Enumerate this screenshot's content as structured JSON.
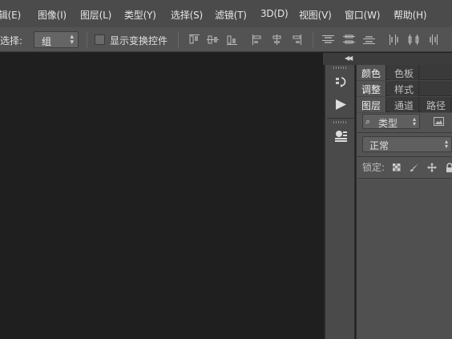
{
  "menubar": {
    "items": [
      {
        "label": "编辑(E)"
      },
      {
        "label": "图像(I)"
      },
      {
        "label": "图层(L)"
      },
      {
        "label": "类型(Y)"
      },
      {
        "label": "选择(S)"
      },
      {
        "label": "滤镜(T)"
      },
      {
        "label": "3D(D)"
      },
      {
        "label": "视图(V)"
      },
      {
        "label": "窗口(W)"
      },
      {
        "label": "帮助(H)"
      }
    ]
  },
  "options": {
    "select_label": "选择:",
    "select_value": "组",
    "show_transform_label": "显示变换控件",
    "show_transform_checked": false
  },
  "dock": {
    "icons": [
      "history-icon",
      "play-action-icon",
      "properties-icon"
    ]
  },
  "panels": {
    "group1": {
      "tabs": [
        "颜色",
        "色板"
      ]
    },
    "group2": {
      "tabs": [
        "调整",
        "样式"
      ]
    },
    "group3": {
      "tabs": [
        "图层",
        "通道",
        "路径"
      ]
    },
    "filter_type": "类型",
    "blend_mode": "正常",
    "lock_label": "锁定:"
  },
  "colors": {
    "menubar_bg": "#4b4b4b",
    "options_bg": "#535353",
    "canvas_bg": "#1f1f1f",
    "panel_bg": "#535353"
  }
}
